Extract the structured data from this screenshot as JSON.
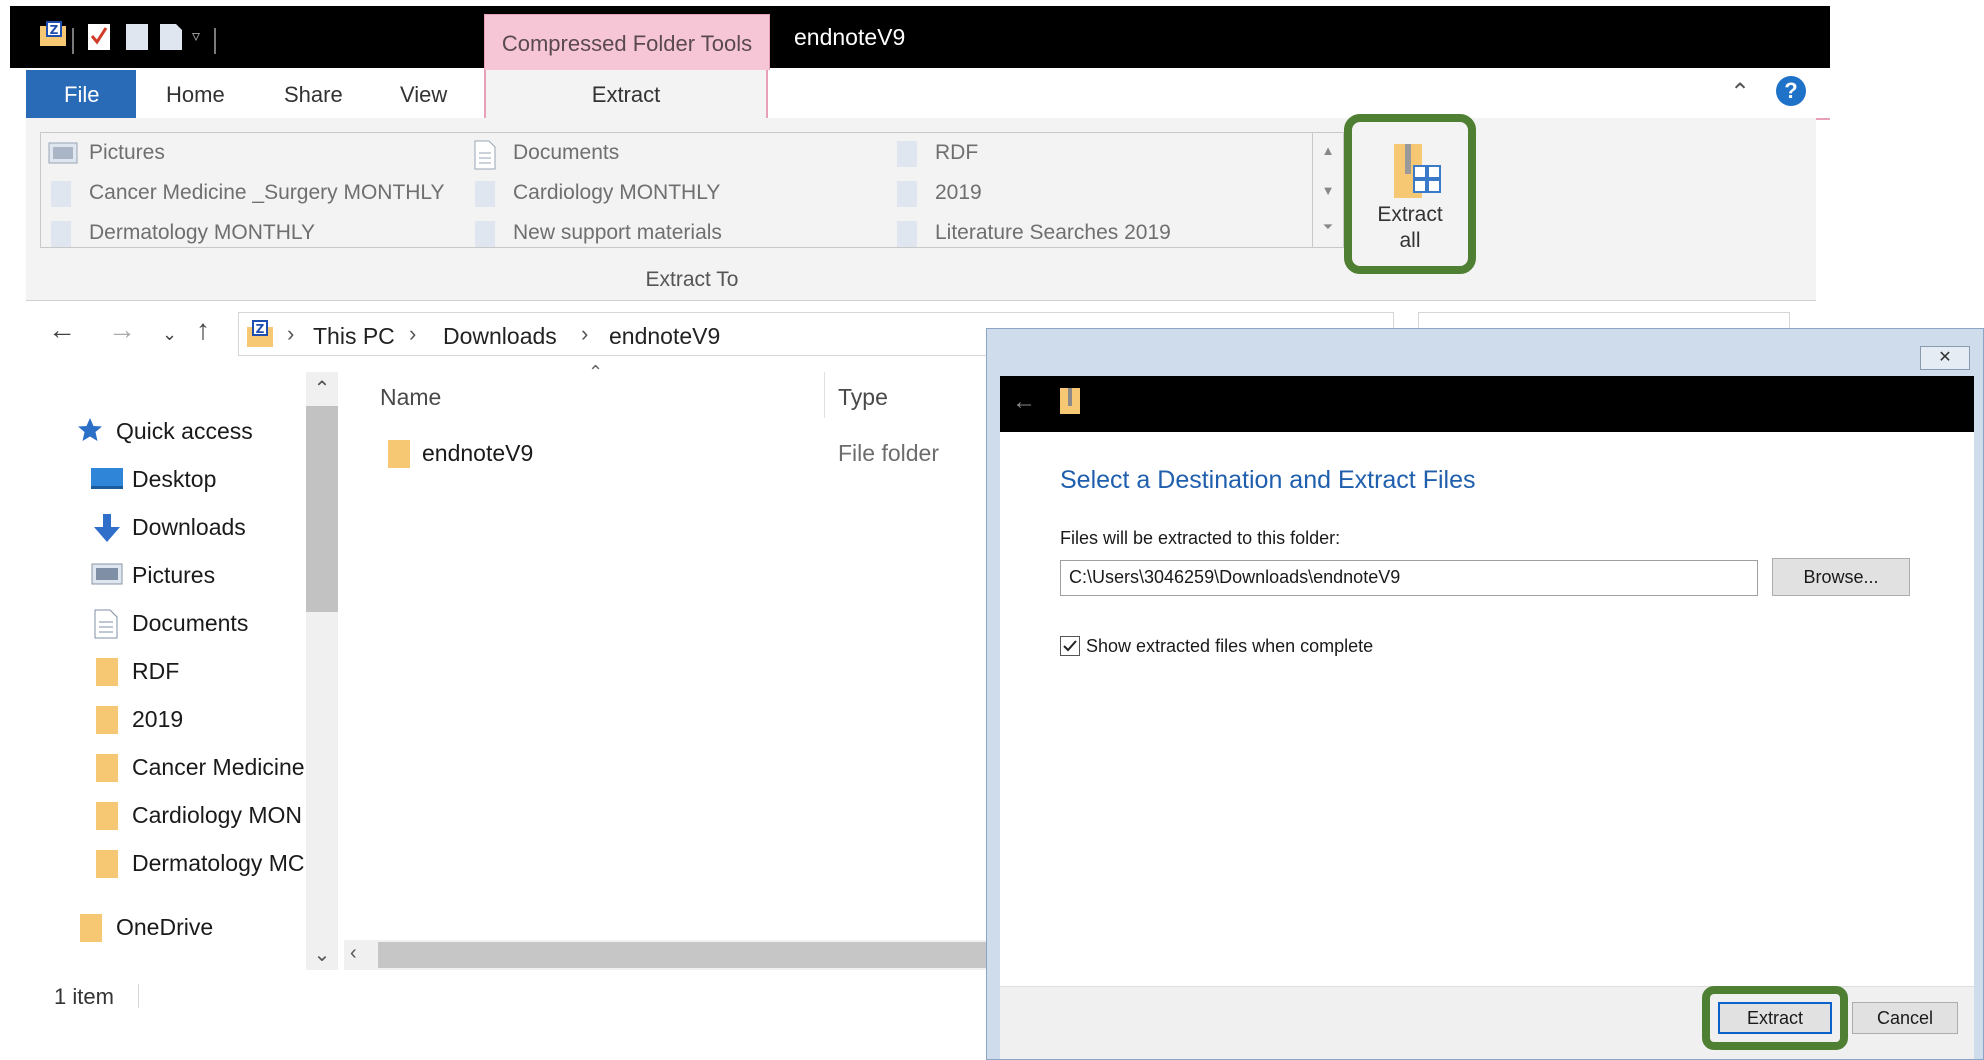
{
  "titlebar": {
    "context_tab": "Compressed Folder Tools",
    "window_title": "endnoteV9"
  },
  "ribbon": {
    "tabs": [
      {
        "label": "File"
      },
      {
        "label": "Home"
      },
      {
        "label": "Share"
      },
      {
        "label": "View"
      },
      {
        "label": "Extract"
      }
    ],
    "gallery": [
      {
        "label": "Pictures",
        "icon": "pictures-folder-icon"
      },
      {
        "label": "Cancer Medicine _Surgery MONTHLY",
        "icon": "folder-icon"
      },
      {
        "label": "Dermatology MONTHLY",
        "icon": "folder-icon"
      },
      {
        "label": "Documents",
        "icon": "documents-folder-icon"
      },
      {
        "label": "Cardiology MONTHLY",
        "icon": "folder-icon"
      },
      {
        "label": "New support materials",
        "icon": "folder-icon"
      },
      {
        "label": "RDF",
        "icon": "folder-icon"
      },
      {
        "label": "2019",
        "icon": "folder-icon"
      },
      {
        "label": "Literature Searches 2019",
        "icon": "folder-icon"
      }
    ],
    "group_label": "Extract To",
    "extract_all_line1": "Extract",
    "extract_all_line2": "all"
  },
  "address": {
    "crumbs": [
      "This PC",
      "Downloads",
      "endnoteV9"
    ]
  },
  "nav": {
    "quick_access": "Quick access",
    "items": [
      {
        "label": "Desktop",
        "icon": "desktop-icon"
      },
      {
        "label": "Downloads",
        "icon": "downloads-icon"
      },
      {
        "label": "Pictures",
        "icon": "pictures-icon"
      },
      {
        "label": "Documents",
        "icon": "documents-icon"
      },
      {
        "label": "RDF",
        "icon": "folder-icon"
      },
      {
        "label": "2019",
        "icon": "folder-icon"
      },
      {
        "label": "Cancer Medicine",
        "icon": "folder-icon"
      },
      {
        "label": "Cardiology MON",
        "icon": "folder-icon"
      },
      {
        "label": "Dermatology MC",
        "icon": "folder-icon"
      }
    ],
    "onedrive": "OneDrive"
  },
  "filelist": {
    "columns": {
      "name": "Name",
      "type": "Type"
    },
    "rows": [
      {
        "name": "endnoteV9",
        "type": "File folder"
      }
    ]
  },
  "status": {
    "count": "1 item"
  },
  "dialog": {
    "heading": "Select a Destination and Extract Files",
    "sublabel": "Files will be extracted to this folder:",
    "path": "C:\\Users\\3046259\\Downloads\\endnoteV9",
    "browse": "Browse...",
    "checkbox_label": "Show extracted files when complete",
    "checkbox_checked": true,
    "extract": "Extract",
    "cancel": "Cancel"
  },
  "colors": {
    "highlight": "#4f7f33",
    "file_tab": "#2a6bb8",
    "context_tab": "#f7c6d6",
    "dialog_heading": "#1f5fad",
    "folder": "#f7c873"
  }
}
